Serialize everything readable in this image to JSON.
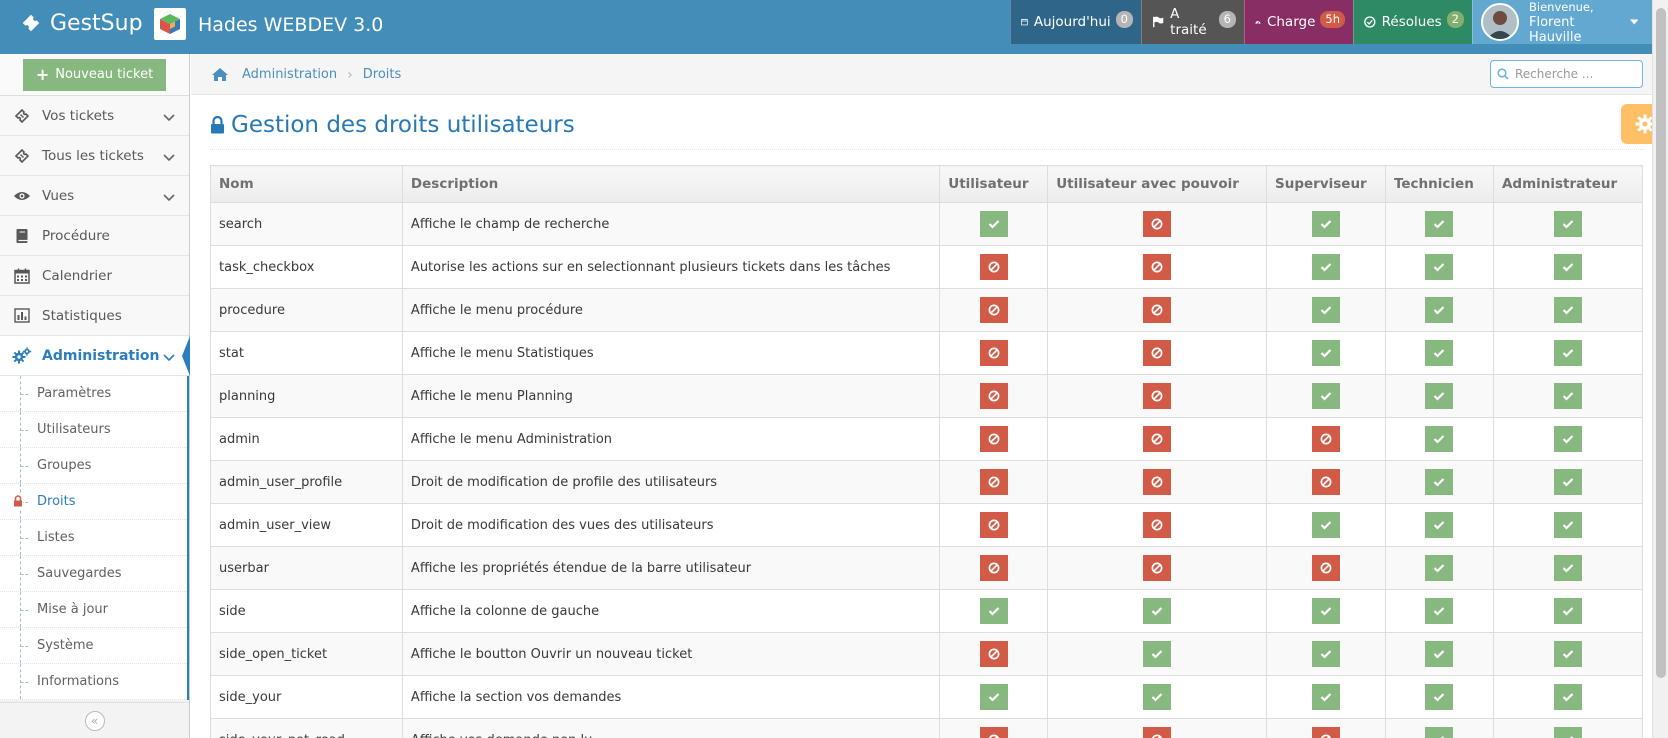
{
  "brand": {
    "name": "GestSup"
  },
  "app": {
    "title": "Hades WEBDEV 3.0"
  },
  "navbar": {
    "today": {
      "label": "Aujourd'hui",
      "badge": "0"
    },
    "treated": {
      "label": "A traité",
      "badge": "6"
    },
    "charge": {
      "label": "Charge",
      "badge": "5h"
    },
    "resolved": {
      "label": "Résolues",
      "badge": "2"
    },
    "user": {
      "greeting": "Bienvenue,",
      "name": "Florent Hauville"
    }
  },
  "sidebar": {
    "new_ticket": "Nouveau ticket",
    "items": [
      {
        "label": "Vos tickets",
        "icon": "ticket-icon",
        "chevron": true
      },
      {
        "label": "Tous les tickets",
        "icon": "ticket-icon",
        "chevron": true
      },
      {
        "label": "Vues",
        "icon": "eye-icon",
        "chevron": true
      },
      {
        "label": "Procédure",
        "icon": "book-icon",
        "chevron": false
      },
      {
        "label": "Calendrier",
        "icon": "calendar-icon",
        "chevron": false
      },
      {
        "label": "Statistiques",
        "icon": "bar-chart-icon",
        "chevron": false
      },
      {
        "label": "Administration",
        "icon": "cogs-icon",
        "chevron": true,
        "active": true
      }
    ],
    "admin_submenu": [
      {
        "label": "Paramètres"
      },
      {
        "label": "Utilisateurs"
      },
      {
        "label": "Groupes"
      },
      {
        "label": "Droits",
        "active": true
      },
      {
        "label": "Listes"
      },
      {
        "label": "Sauvegardes"
      },
      {
        "label": "Mise à jour"
      },
      {
        "label": "Système"
      },
      {
        "label": "Informations"
      }
    ]
  },
  "breadcrumb": {
    "items": [
      "Administration",
      "Droits"
    ]
  },
  "search": {
    "placeholder": "Recherche ..."
  },
  "page": {
    "title": "Gestion des droits utilisateurs"
  },
  "colors": {
    "accent": "#438eb9",
    "ok": "#87b87f",
    "no": "#d15b47",
    "title": "#2679b5"
  },
  "table": {
    "columns": [
      "Nom",
      "Description",
      "Utilisateur",
      "Utilisateur avec pouvoir",
      "Superviseur",
      "Technicien",
      "Administrateur"
    ],
    "rows": [
      {
        "name": "search",
        "description": "Affiche le champ de recherche",
        "rights": [
          true,
          false,
          true,
          true,
          true
        ]
      },
      {
        "name": "task_checkbox",
        "description": "Autorise les actions sur en selectionnant plusieurs tickets dans les tâches",
        "rights": [
          false,
          false,
          true,
          true,
          true
        ]
      },
      {
        "name": "procedure",
        "description": "Affiche le menu procédure",
        "rights": [
          false,
          false,
          true,
          true,
          true
        ]
      },
      {
        "name": "stat",
        "description": "Affiche le menu Statistiques",
        "rights": [
          false,
          false,
          true,
          true,
          true
        ]
      },
      {
        "name": "planning",
        "description": "Affiche le menu Planning",
        "rights": [
          false,
          false,
          true,
          true,
          true
        ]
      },
      {
        "name": "admin",
        "description": "Affiche le menu Administration",
        "rights": [
          false,
          false,
          false,
          true,
          true
        ]
      },
      {
        "name": "admin_user_profile",
        "description": "Droit de modification de profile des utilisateurs",
        "rights": [
          false,
          false,
          false,
          true,
          true
        ]
      },
      {
        "name": "admin_user_view",
        "description": "Droit de modification des vues des utilisateurs",
        "rights": [
          false,
          false,
          true,
          true,
          true
        ]
      },
      {
        "name": "userbar",
        "description": "Affiche les propriétés étendue de la barre utilisateur",
        "rights": [
          false,
          false,
          false,
          true,
          true
        ]
      },
      {
        "name": "side",
        "description": "Affiche la colonne de gauche",
        "rights": [
          true,
          true,
          true,
          true,
          true
        ]
      },
      {
        "name": "side_open_ticket",
        "description": "Affiche le boutton Ouvrir un nouveau ticket",
        "rights": [
          false,
          true,
          true,
          true,
          true
        ]
      },
      {
        "name": "side_your",
        "description": "Affiche la section vos demandes",
        "rights": [
          true,
          true,
          true,
          true,
          true
        ]
      },
      {
        "name": "side_your_not_read",
        "description": "Affiche vos demande non lu",
        "rights": [
          false,
          false,
          false,
          true,
          true
        ]
      }
    ]
  }
}
